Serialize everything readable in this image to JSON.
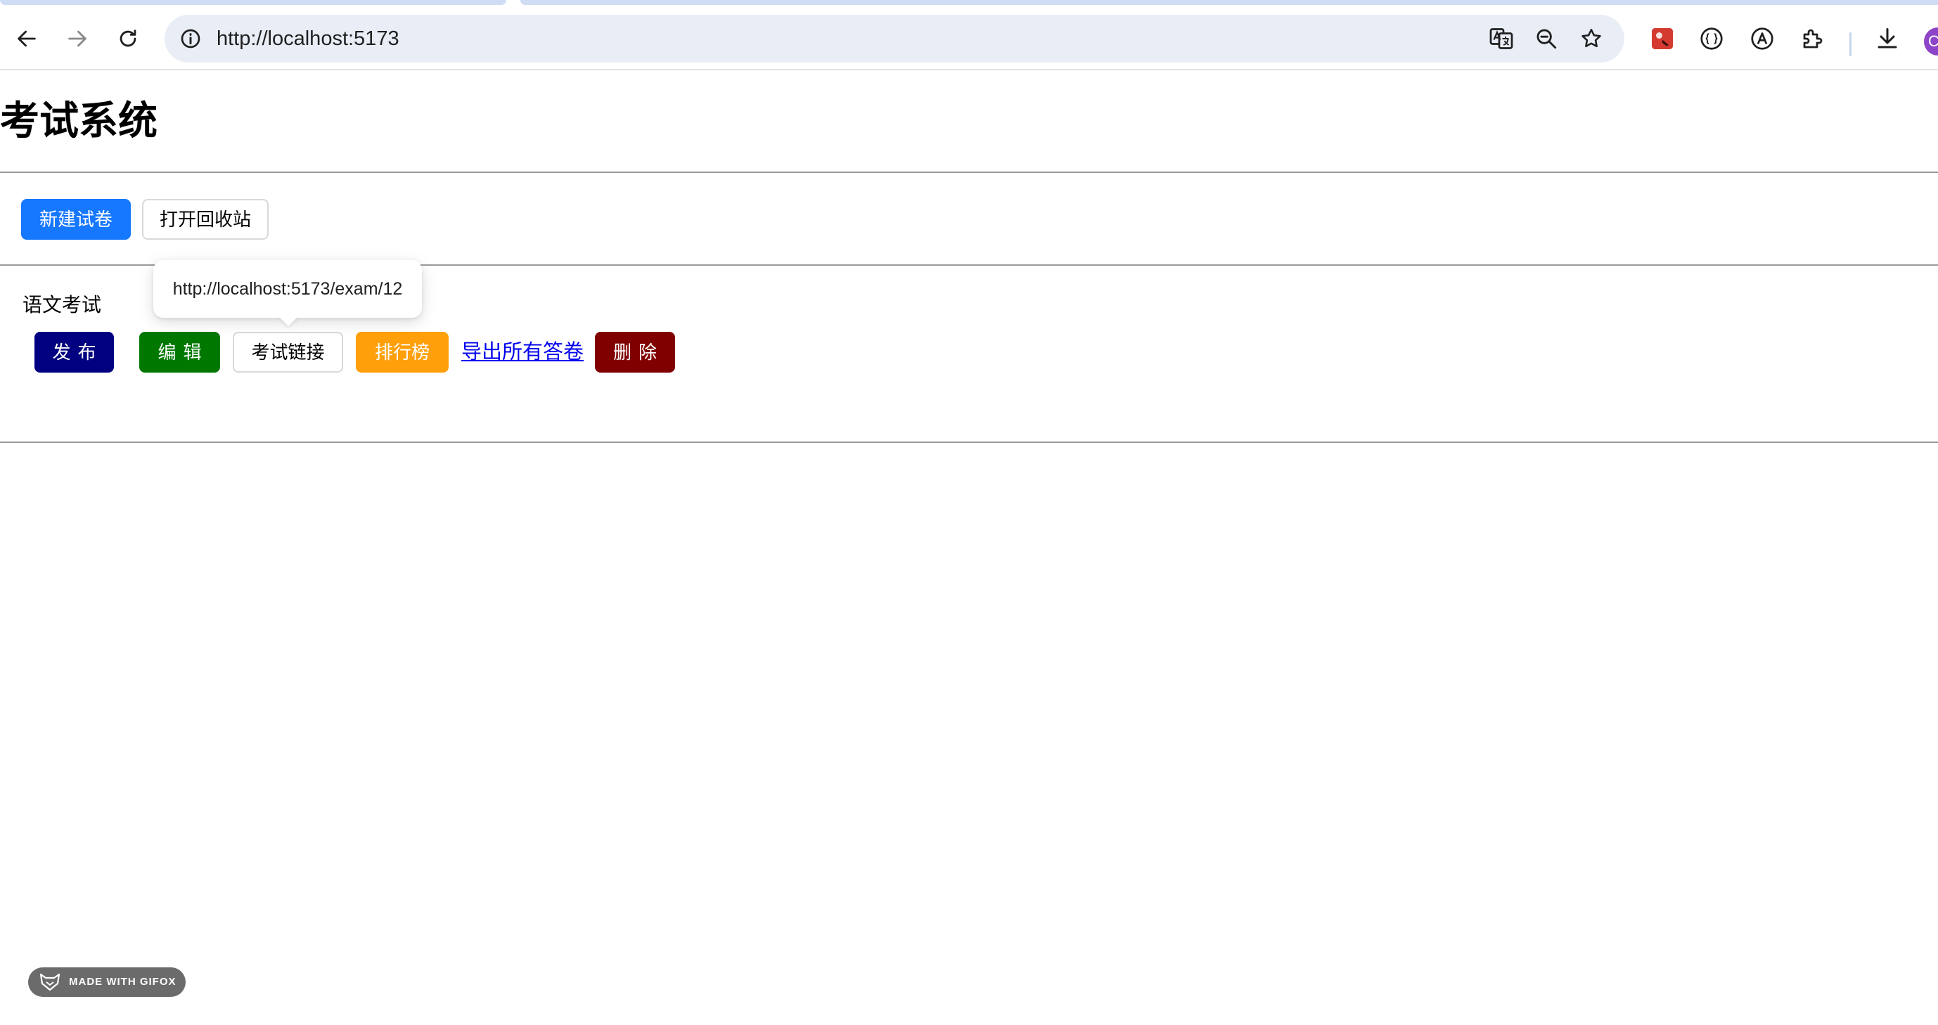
{
  "browser": {
    "url": "http://localhost:5173",
    "profile_initial": "C",
    "icons": {
      "back": "arrow-left-icon",
      "forward": "arrow-right-icon",
      "reload": "reload-icon",
      "site_info": "info-circle-icon",
      "translate": "translate-icon",
      "zoom": "zoom-out-icon",
      "bookmark": "star-icon",
      "extension_red": "red-extension-icon",
      "extension_circle": "braces-circle-icon",
      "extension_a": "letter-a-circle-icon",
      "extensions": "puzzle-icon",
      "download": "download-icon"
    }
  },
  "page": {
    "title": "考试系统",
    "toolbar": {
      "new_exam_label": "新建试卷",
      "recycle_bin_label": "打开回收站"
    },
    "exams": [
      {
        "name": "语文考试",
        "actions": {
          "publish": "发布",
          "edit": "编辑",
          "link": "考试链接",
          "leaderboard": "排行榜",
          "export": "导出所有答卷",
          "delete": "删除"
        },
        "tooltip": "http://localhost:5173/exam/12"
      }
    ]
  },
  "overlay": {
    "gifox_label": "MADE WITH GIFOX"
  },
  "colors": {
    "primary": "#1677ff",
    "publish": "#000080",
    "edit": "#007800",
    "leaderboard": "#ff9f0a",
    "delete": "#800000",
    "link": "#0000ee"
  }
}
